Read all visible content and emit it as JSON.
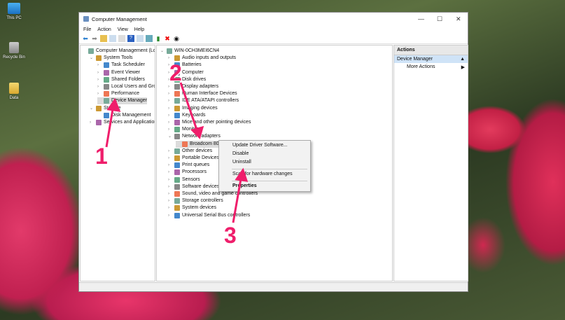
{
  "desktop": {
    "icons": [
      {
        "label": "This PC",
        "icon": "computer-icon"
      },
      {
        "label": "Recycle Bin",
        "icon": "recycle-bin-icon"
      },
      {
        "label": "Data",
        "icon": "folder-icon"
      }
    ]
  },
  "window": {
    "title": "Computer Management",
    "controls": {
      "minimize": "—",
      "maximize": "☐",
      "close": "✕"
    },
    "menu": [
      "File",
      "Action",
      "View",
      "Help"
    ]
  },
  "left_tree": [
    {
      "label": "Computer Management (Local",
      "level": 0,
      "chev": ""
    },
    {
      "label": "System Tools",
      "level": 1,
      "chev": "v"
    },
    {
      "label": "Task Scheduler",
      "level": 2,
      "chev": ">"
    },
    {
      "label": "Event Viewer",
      "level": 2,
      "chev": ">"
    },
    {
      "label": "Shared Folders",
      "level": 2,
      "chev": ">"
    },
    {
      "label": "Local Users and Groups",
      "level": 2,
      "chev": ">"
    },
    {
      "label": "Performance",
      "level": 2,
      "chev": ">"
    },
    {
      "label": "Device Manager",
      "level": 2,
      "chev": "",
      "selected": true
    },
    {
      "label": "Storage",
      "level": 1,
      "chev": "v"
    },
    {
      "label": "Disk Management",
      "level": 2,
      "chev": ""
    },
    {
      "label": "Services and Applications",
      "level": 1,
      "chev": ">"
    }
  ],
  "device_tree": [
    {
      "label": "WIN-0CH3MEI6CN4",
      "level": 0,
      "chev": "v"
    },
    {
      "label": "Audio inputs and outputs",
      "level": 1,
      "chev": ">"
    },
    {
      "label": "Batteries",
      "level": 1,
      "chev": ">"
    },
    {
      "label": "Computer",
      "level": 1,
      "chev": ">"
    },
    {
      "label": "Disk drives",
      "level": 1,
      "chev": ">"
    },
    {
      "label": "Display adapters",
      "level": 1,
      "chev": ">"
    },
    {
      "label": "Human Interface Devices",
      "level": 1,
      "chev": ">"
    },
    {
      "label": "IDE ATA/ATAPI controllers",
      "level": 1,
      "chev": ">"
    },
    {
      "label": "Imaging devices",
      "level": 1,
      "chev": ">"
    },
    {
      "label": "Keyboards",
      "level": 1,
      "chev": ">"
    },
    {
      "label": "Mice and other pointing devices",
      "level": 1,
      "chev": ">"
    },
    {
      "label": "Monitors",
      "level": 1,
      "chev": ">"
    },
    {
      "label": "Network adapters",
      "level": 1,
      "chev": "v"
    },
    {
      "label": "Broadcom 802",
      "level": 2,
      "chev": "",
      "selected": true
    },
    {
      "label": "Other devices",
      "level": 1,
      "chev": ">"
    },
    {
      "label": "Portable Devices",
      "level": 1,
      "chev": ">"
    },
    {
      "label": "Print queues",
      "level": 1,
      "chev": ">"
    },
    {
      "label": "Processors",
      "level": 1,
      "chev": ">"
    },
    {
      "label": "Sensors",
      "level": 1,
      "chev": ">"
    },
    {
      "label": "Software devices",
      "level": 1,
      "chev": ">"
    },
    {
      "label": "Sound, video and game controllers",
      "level": 1,
      "chev": ">"
    },
    {
      "label": "Storage controllers",
      "level": 1,
      "chev": ">"
    },
    {
      "label": "System devices",
      "level": 1,
      "chev": ">"
    },
    {
      "label": "Universal Serial Bus controllers",
      "level": 1,
      "chev": ">"
    }
  ],
  "context_menu": [
    "Update Driver Software...",
    "Disable",
    "Uninstall",
    "Scan for hardware changes",
    "Properties"
  ],
  "actions": {
    "header": "Actions",
    "section": "Device Manager",
    "items": [
      "More Actions"
    ]
  },
  "annotations": [
    "1",
    "2",
    "3"
  ],
  "colors": {
    "annotation": "#ef1e6b",
    "selection": "#cfe3f7"
  }
}
